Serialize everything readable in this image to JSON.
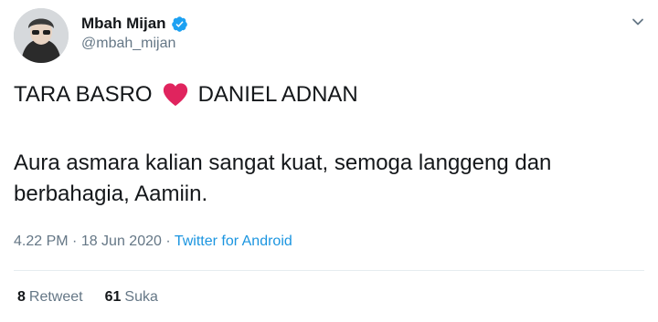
{
  "user": {
    "display_name": "Mbah Mijan",
    "handle": "@mbah_mijan",
    "verified_icon": "verified-badge-icon",
    "avatar_bg": "#cfd3d6"
  },
  "tweet": {
    "line1_left": "TARA BASRO",
    "heart_icon": "red-heart-emoji-icon",
    "line1_right": "DANIEL ADNAN",
    "line2": "Aura asmara kalian sangat kuat, semoga langgeng dan",
    "line3": "berbahagia, Aamiin."
  },
  "meta": {
    "time": "4.22 PM",
    "sep1": " · ",
    "date": "18 Jun 2020",
    "sep2": " · ",
    "source": "Twitter for Android"
  },
  "stats": {
    "retweets_count": "8",
    "retweets_label": "Retweet",
    "likes_count": "61",
    "likes_label": "Suka"
  },
  "colors": {
    "text": "#14171a",
    "muted": "#657786",
    "link": "#1b95e0",
    "verified": "#1da1f2",
    "heart": "#e0245e",
    "divider": "#e6ecf0"
  }
}
